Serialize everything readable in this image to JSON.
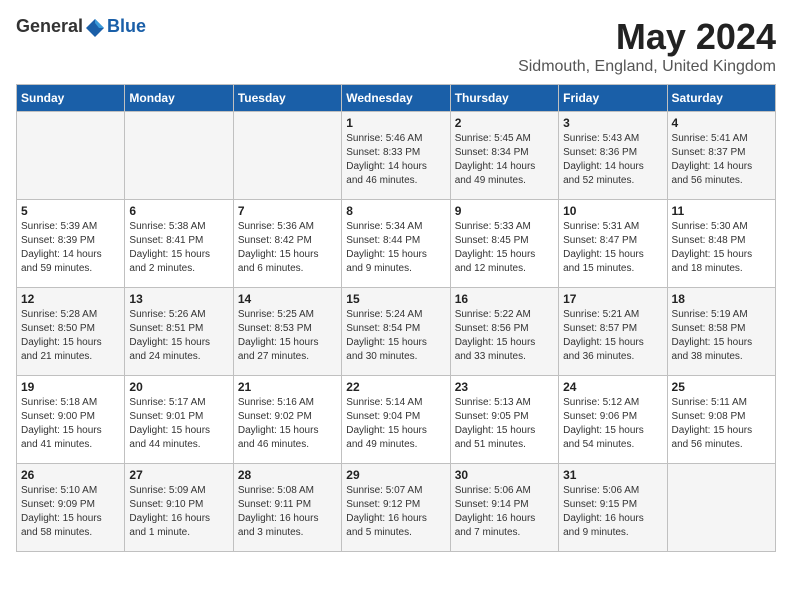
{
  "header": {
    "logo_general": "General",
    "logo_blue": "Blue",
    "month_year": "May 2024",
    "location": "Sidmouth, England, United Kingdom"
  },
  "days_of_week": [
    "Sunday",
    "Monday",
    "Tuesday",
    "Wednesday",
    "Thursday",
    "Friday",
    "Saturday"
  ],
  "weeks": [
    [
      {
        "day": "",
        "info": ""
      },
      {
        "day": "",
        "info": ""
      },
      {
        "day": "",
        "info": ""
      },
      {
        "day": "1",
        "info": "Sunrise: 5:46 AM\nSunset: 8:33 PM\nDaylight: 14 hours\nand 46 minutes."
      },
      {
        "day": "2",
        "info": "Sunrise: 5:45 AM\nSunset: 8:34 PM\nDaylight: 14 hours\nand 49 minutes."
      },
      {
        "day": "3",
        "info": "Sunrise: 5:43 AM\nSunset: 8:36 PM\nDaylight: 14 hours\nand 52 minutes."
      },
      {
        "day": "4",
        "info": "Sunrise: 5:41 AM\nSunset: 8:37 PM\nDaylight: 14 hours\nand 56 minutes."
      }
    ],
    [
      {
        "day": "5",
        "info": "Sunrise: 5:39 AM\nSunset: 8:39 PM\nDaylight: 14 hours\nand 59 minutes."
      },
      {
        "day": "6",
        "info": "Sunrise: 5:38 AM\nSunset: 8:41 PM\nDaylight: 15 hours\nand 2 minutes."
      },
      {
        "day": "7",
        "info": "Sunrise: 5:36 AM\nSunset: 8:42 PM\nDaylight: 15 hours\nand 6 minutes."
      },
      {
        "day": "8",
        "info": "Sunrise: 5:34 AM\nSunset: 8:44 PM\nDaylight: 15 hours\nand 9 minutes."
      },
      {
        "day": "9",
        "info": "Sunrise: 5:33 AM\nSunset: 8:45 PM\nDaylight: 15 hours\nand 12 minutes."
      },
      {
        "day": "10",
        "info": "Sunrise: 5:31 AM\nSunset: 8:47 PM\nDaylight: 15 hours\nand 15 minutes."
      },
      {
        "day": "11",
        "info": "Sunrise: 5:30 AM\nSunset: 8:48 PM\nDaylight: 15 hours\nand 18 minutes."
      }
    ],
    [
      {
        "day": "12",
        "info": "Sunrise: 5:28 AM\nSunset: 8:50 PM\nDaylight: 15 hours\nand 21 minutes."
      },
      {
        "day": "13",
        "info": "Sunrise: 5:26 AM\nSunset: 8:51 PM\nDaylight: 15 hours\nand 24 minutes."
      },
      {
        "day": "14",
        "info": "Sunrise: 5:25 AM\nSunset: 8:53 PM\nDaylight: 15 hours\nand 27 minutes."
      },
      {
        "day": "15",
        "info": "Sunrise: 5:24 AM\nSunset: 8:54 PM\nDaylight: 15 hours\nand 30 minutes."
      },
      {
        "day": "16",
        "info": "Sunrise: 5:22 AM\nSunset: 8:56 PM\nDaylight: 15 hours\nand 33 minutes."
      },
      {
        "day": "17",
        "info": "Sunrise: 5:21 AM\nSunset: 8:57 PM\nDaylight: 15 hours\nand 36 minutes."
      },
      {
        "day": "18",
        "info": "Sunrise: 5:19 AM\nSunset: 8:58 PM\nDaylight: 15 hours\nand 38 minutes."
      }
    ],
    [
      {
        "day": "19",
        "info": "Sunrise: 5:18 AM\nSunset: 9:00 PM\nDaylight: 15 hours\nand 41 minutes."
      },
      {
        "day": "20",
        "info": "Sunrise: 5:17 AM\nSunset: 9:01 PM\nDaylight: 15 hours\nand 44 minutes."
      },
      {
        "day": "21",
        "info": "Sunrise: 5:16 AM\nSunset: 9:02 PM\nDaylight: 15 hours\nand 46 minutes."
      },
      {
        "day": "22",
        "info": "Sunrise: 5:14 AM\nSunset: 9:04 PM\nDaylight: 15 hours\nand 49 minutes."
      },
      {
        "day": "23",
        "info": "Sunrise: 5:13 AM\nSunset: 9:05 PM\nDaylight: 15 hours\nand 51 minutes."
      },
      {
        "day": "24",
        "info": "Sunrise: 5:12 AM\nSunset: 9:06 PM\nDaylight: 15 hours\nand 54 minutes."
      },
      {
        "day": "25",
        "info": "Sunrise: 5:11 AM\nSunset: 9:08 PM\nDaylight: 15 hours\nand 56 minutes."
      }
    ],
    [
      {
        "day": "26",
        "info": "Sunrise: 5:10 AM\nSunset: 9:09 PM\nDaylight: 15 hours\nand 58 minutes."
      },
      {
        "day": "27",
        "info": "Sunrise: 5:09 AM\nSunset: 9:10 PM\nDaylight: 16 hours\nand 1 minute."
      },
      {
        "day": "28",
        "info": "Sunrise: 5:08 AM\nSunset: 9:11 PM\nDaylight: 16 hours\nand 3 minutes."
      },
      {
        "day": "29",
        "info": "Sunrise: 5:07 AM\nSunset: 9:12 PM\nDaylight: 16 hours\nand 5 minutes."
      },
      {
        "day": "30",
        "info": "Sunrise: 5:06 AM\nSunset: 9:14 PM\nDaylight: 16 hours\nand 7 minutes."
      },
      {
        "day": "31",
        "info": "Sunrise: 5:06 AM\nSunset: 9:15 PM\nDaylight: 16 hours\nand 9 minutes."
      },
      {
        "day": "",
        "info": ""
      }
    ]
  ]
}
